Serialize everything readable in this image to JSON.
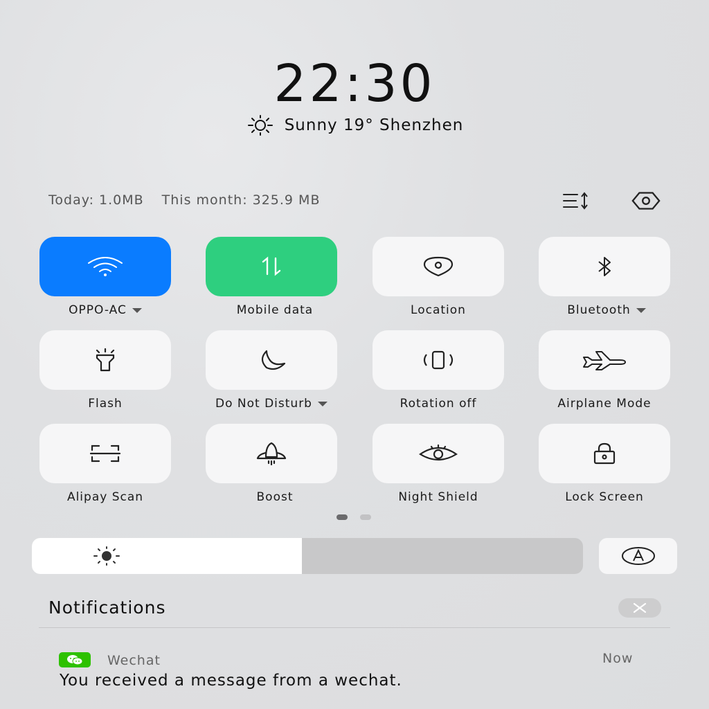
{
  "lockscreen": {
    "time": "22:30",
    "weather": "Sunny 19° Shenzhen",
    "weather_icon": "sun-icon"
  },
  "usage": {
    "today": "Today: 1.0MB",
    "month": "This month: 325.9 MB"
  },
  "top_icons": [
    "edit-tiles-icon",
    "settings-icon"
  ],
  "toggles": [
    {
      "label": "OPPO-AC",
      "icon": "wifi-icon",
      "state": "on",
      "color": "#0a7cff",
      "has_menu": true
    },
    {
      "label": "Mobile data",
      "icon": "mobile-data-icon",
      "state": "on",
      "color": "#2ecf7f",
      "has_menu": false
    },
    {
      "label": "Location",
      "icon": "location-icon",
      "state": "off",
      "has_menu": false
    },
    {
      "label": "Bluetooth",
      "icon": "bluetooth-icon",
      "state": "off",
      "has_menu": true
    },
    {
      "label": "Flash",
      "icon": "flashlight-icon",
      "state": "off",
      "has_menu": false
    },
    {
      "label": "Do Not Disturb",
      "icon": "moon-icon",
      "state": "off",
      "has_menu": true
    },
    {
      "label": "Rotation off",
      "icon": "rotation-icon",
      "state": "off",
      "has_menu": false
    },
    {
      "label": "Airplane Mode",
      "icon": "airplane-icon",
      "state": "off",
      "has_menu": false
    },
    {
      "label": "Alipay Scan",
      "icon": "scan-icon",
      "state": "off",
      "has_menu": false
    },
    {
      "label": "Boost",
      "icon": "rocket-icon",
      "state": "off",
      "has_menu": false
    },
    {
      "label": "Night Shield",
      "icon": "eye-icon",
      "state": "off",
      "has_menu": false
    },
    {
      "label": "Lock Screen",
      "icon": "lock-icon",
      "state": "off",
      "has_menu": false
    }
  ],
  "pager": {
    "pages": 2,
    "current": 1
  },
  "brightness": {
    "level": 0.49,
    "auto_icon": "auto-brightness-icon"
  },
  "notifications": {
    "title": "Notifications",
    "items": [
      {
        "app": "Wechat",
        "time": "Now",
        "message": "You received a message from a wechat."
      }
    ]
  }
}
